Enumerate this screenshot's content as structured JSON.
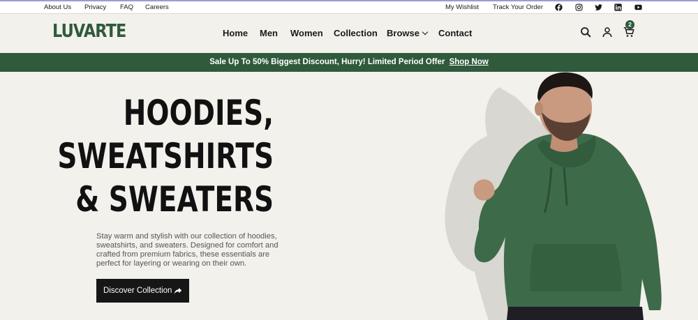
{
  "topbar": {
    "links": [
      "About Us",
      "Privacy",
      "FAQ",
      "Careers"
    ],
    "right_links": [
      "My Wishlist",
      "Track Your Order"
    ],
    "social_icons": [
      "facebook-icon",
      "instagram-icon",
      "twitter-icon",
      "linkedin-icon",
      "youtube-icon"
    ]
  },
  "header": {
    "logo": "LUVARTE",
    "nav": [
      "Home",
      "Men",
      "Women",
      "Collection",
      "Browse",
      "Contact"
    ],
    "icons": [
      "search-icon",
      "user-icon",
      "cart-icon"
    ],
    "cart_count": "2"
  },
  "promo": {
    "text": "Sale Up To 50% Biggest Discount, Hurry! Limited Period Offer",
    "link": "Shop Now"
  },
  "hero": {
    "title_lines": [
      "HOODIES,",
      "SWEATSHIRTS",
      "& SWEATERS"
    ],
    "description": "Stay warm and stylish with our collection of hoodies, sweatshirts, and sweaters. Designed for comfort and crafted from premium fabrics, these essentials are perfect for layering or wearing on their own.",
    "cta_label": "Discover Collection",
    "cta_icon": "share-arrow-icon"
  },
  "colors": {
    "brand_green": "#2f5a3c",
    "background": "#f2f1ec",
    "hoodie_green": "#3d6b4a",
    "cta_bg": "#161616"
  }
}
